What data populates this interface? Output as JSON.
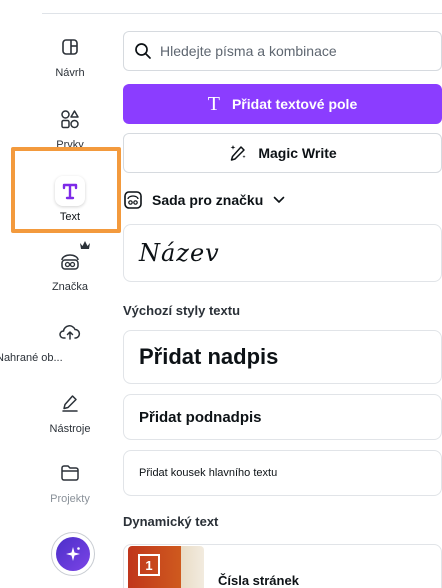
{
  "sidebar": {
    "items": [
      {
        "label": "Návrh",
        "icon": "layout-icon"
      },
      {
        "label": "Prvky",
        "icon": "elements-icon"
      },
      {
        "label": "Text",
        "icon": "text-icon"
      },
      {
        "label": "Značka",
        "icon": "brand-icon"
      },
      {
        "label": "Nahrané ob...",
        "icon": "upload-cloud-icon"
      },
      {
        "label": "Nástroje",
        "icon": "draw-tools-icon"
      },
      {
        "label": "Projekty",
        "icon": "folder-icon"
      }
    ],
    "active": "Text",
    "magic_icon": "sparkle-icon"
  },
  "search": {
    "placeholder": "Hledejte písma a kombinace"
  },
  "add_textbox": {
    "glyph": "T",
    "label": "Přidat textové pole"
  },
  "magic_write": {
    "label": "Magic Write"
  },
  "brand_kit": {
    "label": "Sada pro značku"
  },
  "brand_sample": {
    "text": "Název"
  },
  "default_styles": {
    "title": "Výchozí styly textu",
    "heading": "Přidat nadpis",
    "subheading": "Přidat podnadpis",
    "body": "Přidat kousek hlavního textu"
  },
  "dynamic_text": {
    "title": "Dynamický text",
    "item_label": "Čísla stránek",
    "item_number": "1"
  },
  "colors": {
    "accent": "#8b3dff",
    "highlight": "#f39a3d"
  }
}
